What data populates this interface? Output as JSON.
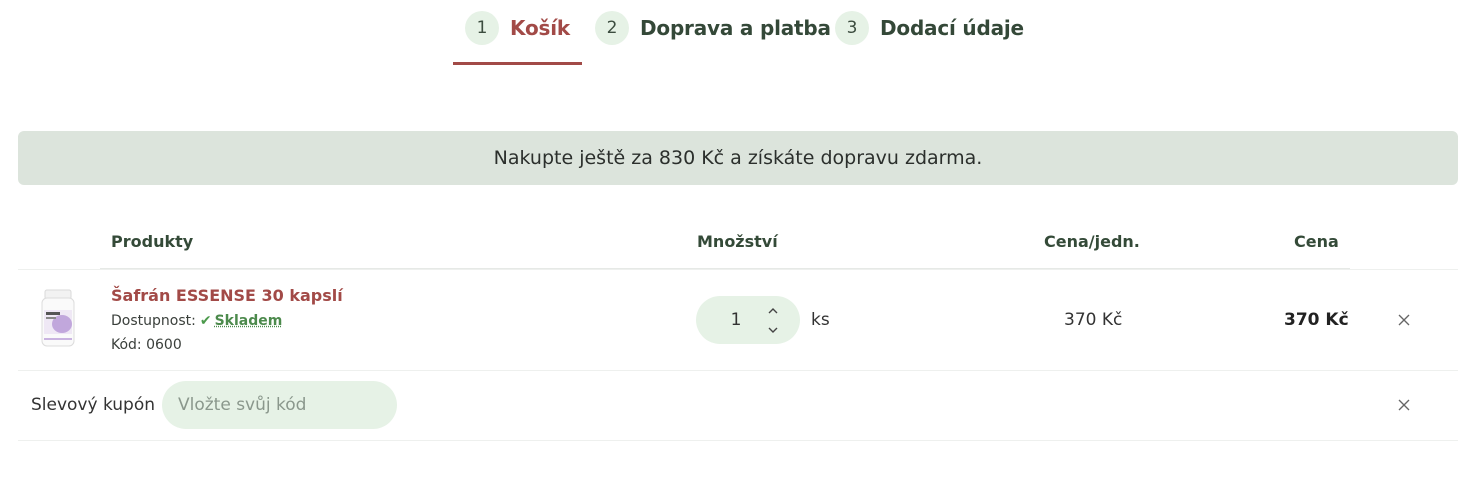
{
  "steps": [
    {
      "number": "1",
      "label": "Košík",
      "active": true
    },
    {
      "number": "2",
      "label": "Doprava a platba",
      "active": false
    },
    {
      "number": "3",
      "label": "Dodací údaje",
      "active": false
    }
  ],
  "banner": {
    "text": "Nakupte ještě za 830 Kč a získáte dopravu zdarma."
  },
  "table": {
    "headers": {
      "products": "Produkty",
      "quantity": "Množství",
      "unit_price": "Cena/jedn.",
      "price": "Cena"
    }
  },
  "product": {
    "name": "Šafrán ESSENSE 30 kapslí",
    "availability_label": "Dostupnost:",
    "availability_value": "Skladem",
    "code": "Kód: 0600",
    "image_icon": "product-bottle-icon",
    "quantity": "1",
    "quantity_unit": "ks",
    "unit_price": "370 Kč",
    "total_price": "370 Kč"
  },
  "coupon": {
    "label": "Slevový kupón",
    "placeholder": "Vložte svůj kód",
    "value": ""
  },
  "colors": {
    "accent": "#a24a47",
    "green_soft": "#e6f2e6",
    "banner_bg": "#dce4dc",
    "heading": "#344838"
  }
}
